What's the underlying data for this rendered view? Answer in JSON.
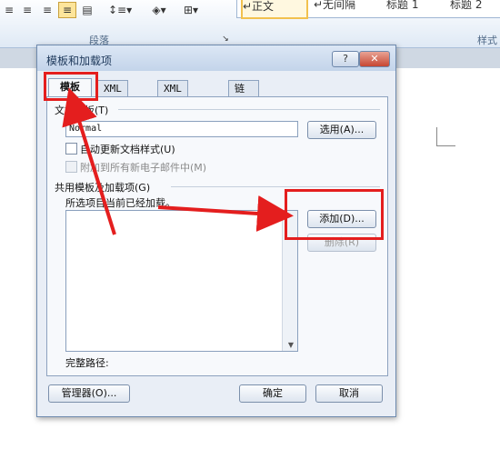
{
  "ribbon": {
    "group_label": "段落",
    "styles_label": "样式",
    "style_items": [
      "↵正文",
      "↵无间隔",
      "标题 1",
      "标题 2"
    ]
  },
  "dialog": {
    "title": "模板和加载项",
    "help_label": "?",
    "close_label": "✕",
    "tabs": [
      "模板",
      "XML 架构",
      "XML 扩展包",
      "链接的 CSS"
    ],
    "doc_template_label": "文档模板(T)",
    "doc_template_value": "Normal",
    "select_button": "选用(A)...",
    "auto_update_label": "自动更新文档样式(U)",
    "attach_email_label": "附加到所有新电子邮件中(M)",
    "global_templates_label": "共用模板及加载项(G)",
    "checked_items_label": "所选项目当前已经加载。",
    "add_button": "添加(D)...",
    "remove_button": "删除(R)",
    "full_path_label": "完整路径:",
    "organizer_button": "管理器(O)...",
    "ok_button": "确定",
    "cancel_button": "取消"
  },
  "colors": {
    "annotation": "#e41e1e"
  }
}
